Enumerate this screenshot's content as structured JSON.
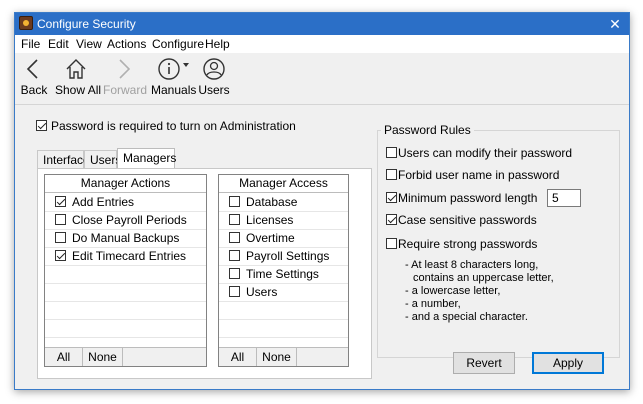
{
  "window": {
    "title": "Configure Security",
    "close_glyph": "✕"
  },
  "menu": [
    "File",
    "Edit",
    "View",
    "Actions",
    "Configure",
    "Help"
  ],
  "toolbar": {
    "back": "Back",
    "show_all": "Show All",
    "forward": "Forward",
    "manuals": "Manuals",
    "users": "Users",
    "icons": {
      "back": "chevron-left-icon",
      "show_all": "home-icon",
      "forward": "chevron-right-icon",
      "manuals": "info-icon",
      "users": "user-icon"
    }
  },
  "admin_password": {
    "label": "Password is required to turn on Administration",
    "checked": true
  },
  "tabs": [
    {
      "label": "Interface",
      "active": false
    },
    {
      "label": "Users",
      "active": false
    },
    {
      "label": "Managers",
      "active": true
    }
  ],
  "manager_actions": {
    "header": "Manager Actions",
    "items": [
      {
        "label": "Add Entries",
        "checked": true
      },
      {
        "label": "Close Payroll Periods",
        "checked": false
      },
      {
        "label": "Do Manual Backups",
        "checked": false
      },
      {
        "label": "Edit Timecard Entries",
        "checked": true
      }
    ],
    "all_label": "All",
    "none_label": "None"
  },
  "manager_access": {
    "header": "Manager Access",
    "items": [
      {
        "label": "Database",
        "checked": false
      },
      {
        "label": "Licenses",
        "checked": false
      },
      {
        "label": "Overtime",
        "checked": false
      },
      {
        "label": "Payroll Settings",
        "checked": false
      },
      {
        "label": "Time Settings",
        "checked": false
      },
      {
        "label": "Users",
        "checked": false
      }
    ],
    "all_label": "All",
    "none_label": "None"
  },
  "password_rules": {
    "title": "Password Rules",
    "users_modify": {
      "label": "Users can modify their password",
      "checked": false
    },
    "forbid_username": {
      "label": "Forbid user name in password",
      "checked": false
    },
    "min_length": {
      "label": "Minimum password length",
      "checked": true,
      "value": "5"
    },
    "case_sensitive": {
      "label": "Case sensitive passwords",
      "checked": true
    },
    "require_strong": {
      "label": "Require strong passwords",
      "checked": false
    },
    "strong_details": [
      "-  At least 8 characters long,",
      "contains an uppercase letter,",
      "-  a lowercase letter,",
      "-  a number,",
      "-  and a special character."
    ]
  },
  "buttons": {
    "revert": "Revert",
    "apply": "Apply"
  },
  "colors": {
    "titlebar": "#2b6fc7",
    "accent": "#0078d7"
  }
}
